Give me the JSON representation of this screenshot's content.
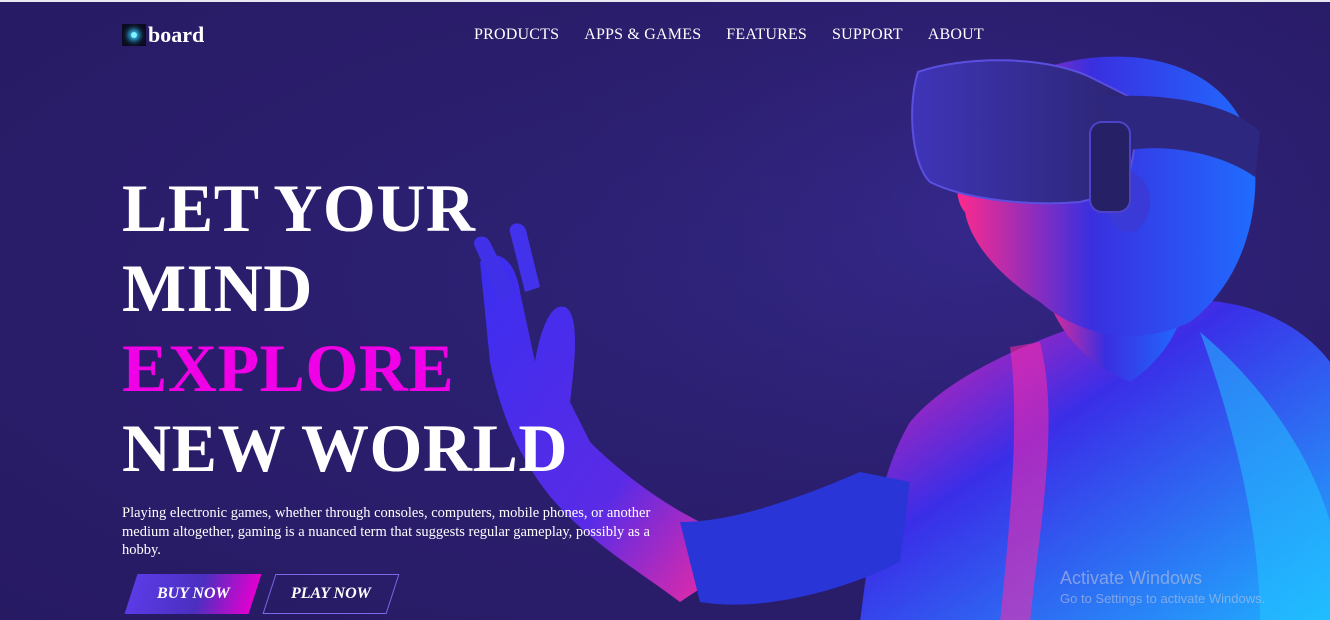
{
  "brand": {
    "logo_text": "board",
    "logo_icon": "glowing-star-icon"
  },
  "nav": {
    "items": [
      {
        "label": "PRODUCTS"
      },
      {
        "label": "APPS & GAMES"
      },
      {
        "label": "FEATURES"
      },
      {
        "label": "SUPPORT"
      },
      {
        "label": "ABOUT"
      }
    ]
  },
  "hero": {
    "lines": [
      "LET YOUR",
      "MIND",
      "EXPLORE",
      "NEW WORLD"
    ],
    "description": "Playing electronic games, whether through consoles, computers, mobile phones, or another medium altogether, gaming is a nuanced term that suggests regular gameplay, possibly as a hobby.",
    "buy_label": "BUY NOW",
    "play_label": "PLAY NOW",
    "image_subject": "person-wearing-vr-headset"
  },
  "watermark": {
    "title": "Activate Windows",
    "subtitle": "Go to Settings to activate Windows."
  },
  "colors": {
    "background": "#2a1d6b",
    "accent_magenta": "#f000e6",
    "accent_blue": "#2b4bff",
    "text": "#ffffff"
  }
}
